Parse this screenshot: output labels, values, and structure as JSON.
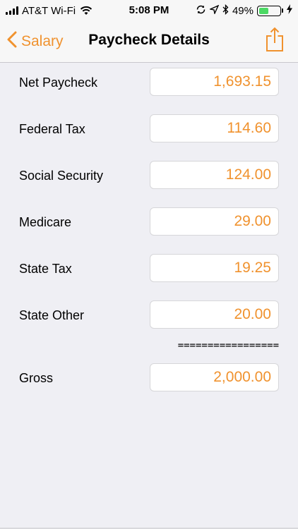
{
  "status_bar": {
    "carrier": "AT&T Wi-Fi",
    "time": "5:08 PM",
    "battery_percent": "49%",
    "battery_level": 0.49,
    "battery_color": "#4cd964"
  },
  "nav": {
    "back_label": "Salary",
    "title": "Paycheck Details",
    "accent_color": "#f0922e"
  },
  "rows": [
    {
      "label": "Net Paycheck",
      "value": "1,693.15"
    },
    {
      "label": "Federal Tax",
      "value": "114.60"
    },
    {
      "label": "Social Security",
      "value": "124.00"
    },
    {
      "label": "Medicare",
      "value": "29.00"
    },
    {
      "label": "State Tax",
      "value": "19.25"
    },
    {
      "label": "State Other",
      "value": "20.00"
    }
  ],
  "separator": "=================",
  "gross": {
    "label": "Gross",
    "value": "2,000.00"
  }
}
